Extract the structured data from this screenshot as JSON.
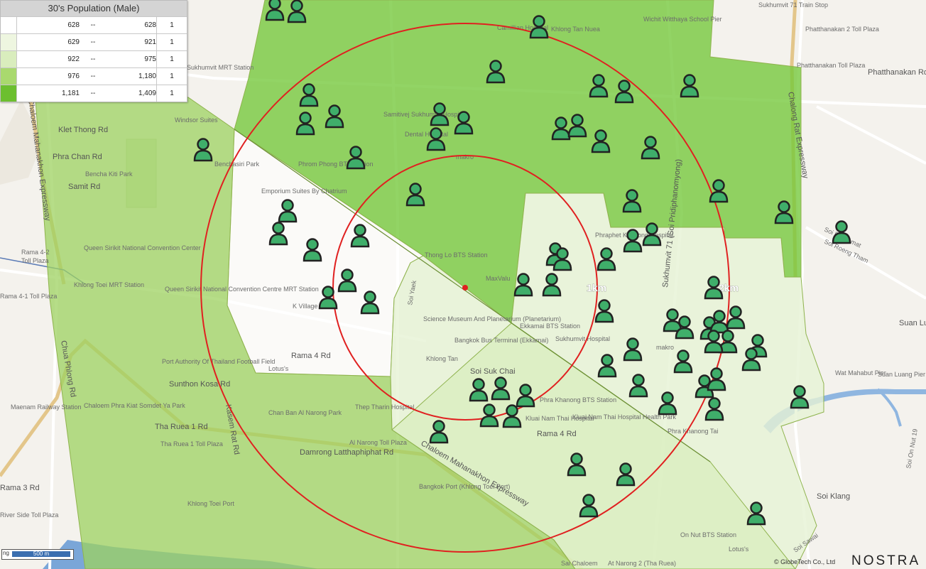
{
  "legend": {
    "title": "30's Population (Male)",
    "rows": [
      {
        "min": "628",
        "sep": "--",
        "max": "628",
        "count": "1",
        "color": "#ffffff"
      },
      {
        "min": "629",
        "sep": "--",
        "max": "921",
        "count": "1",
        "color": "#eef6e0"
      },
      {
        "min": "922",
        "sep": "--",
        "max": "975",
        "count": "1",
        "color": "#d9edbd"
      },
      {
        "min": "976",
        "sep": "--",
        "max": "1,180",
        "count": "1",
        "color": "#a9d96e"
      },
      {
        "min": "1,181",
        "sep": "--",
        "max": "1,409",
        "count": "1",
        "color": "#6cbf2f"
      }
    ]
  },
  "rings": {
    "inner": "1km",
    "outer": "2km"
  },
  "scale": {
    "label": "500 m",
    "prefix": "ng"
  },
  "copyright": "© GlobeTech Co., Ltd",
  "brand": "NOSTRA",
  "place_labels": {
    "sukhumvit_mrt": "Sukhumvit MRT Station",
    "klet_thong": "Klet Thong Rd",
    "phra_chan": "Phra Chan Rd",
    "samit": "Samit Rd",
    "benchakitti_park": "Bencha Kiti Park",
    "rama42": "Rama 4-2",
    "toll_plaza": "Toll Plaza",
    "rama41": "Rama 4-1 Toll Plaza",
    "qsncc": "Queen Sirikit National Convention Center",
    "khlong_toei_mrt": "Khlong Toei MRT Station",
    "qsncc_mrt": "Queen Sirikit National Convention Centre MRT Station",
    "port_authority": "Port Authority Of Thailand Football Field",
    "sunthon_kosa": "Sunthon Kosa Rd",
    "maenam_railway": "Maenam Railway Station",
    "chaloem_phra_kiat": "Chaloem Phra Kiat Somdet Ya Park",
    "tha_ruea_1": "Tha Ruea 1 Rd",
    "tha_ruea_toll": "Tha Ruea 1 Toll Plaza",
    "rama3": "Rama 3 Rd",
    "river_side": "River Side Toll Plaza",
    "klong_toei_port": "Khlong Toei Port",
    "damrong": "Damrong Latthaphiphat Rd",
    "bangkok_port": "Bangkok Port (Khlong Toei Port)",
    "al_narong_toll": "Al Narong Toll Plaza",
    "chan_ban": "Chan Ban Al Narong Park",
    "kasem_rat": "Kasem Rat Rd",
    "rama4": "Rama 4 Rd",
    "rama4b": "Rama 4 Rd",
    "lotus": "Lotus's",
    "k_village": "K Village",
    "emporium": "Emporium Suites By Chatrium",
    "phrom_phong": "Phrom Phong BTS Station",
    "benchasiri": "Benchasiri Park",
    "thong_lo": "Thong Lo BTS Station",
    "samitivej": "Samitivej Sukhumvit Hospital",
    "dental": "Dental Hospital",
    "camillian": "Camillian Hospital",
    "khlong_tan_nuea": "Khlong Tan Nuea",
    "sukhumvit71": "Sukhumvit 71 Train Stop",
    "phatthanakan_2": "Phatthanakan 2 Toll Plaza",
    "phatthanakan_tp": "Phatthanakan Toll Plaza",
    "phatthanakan_rd": "Phatthanakan Rd",
    "chalong_rat": "Chalong Rat Expressway",
    "wichit": "Wichit Witthaya School Pier",
    "soi_pridi": "Sukhumvit 71 (Soi Pridiphanomyong)",
    "soi_phakamat": "Soi Phakamat",
    "soi_roeng_tham": "Soi Roeng Tham",
    "phrakhanong_hosp": "Phraphet Khanong Hospital",
    "science_museum": "Science Museum And Planetarium (Planetarium)",
    "ekkamai_bts": "Ekkamai BTS Station",
    "sukhumvit_hosp": "Sukhumvit Hospital",
    "bangkok_bus": "Bangkok Bus Terminal (Ekkamai)",
    "soi_suk_chai": "Soi Suk Chai",
    "thep_tharin": "Thep Tharin Hospital",
    "phra_khanong_bts": "Phra Khanong BTS Station",
    "kluai_nam_thai": "Kluai Nam Thai Hospital",
    "kluai_nam_thai_hc": "Kluai Nam Thai Hospital Health Park",
    "chaloem_maha_exp": "Chaloem Mahanakhon Expressway",
    "chaloem_maha_exp2": "Chaloem Mahanakhon Expressway",
    "phra_khanong": "Phra Khanong Tai",
    "on_nut_bts": "On Nut BTS Station",
    "soi_klang": "Soi Klang",
    "soi_sawai": "Soi Sawai",
    "wat_mahabut": "Wat Mahabut Pier",
    "suan_luang": "Suan Luang Pier",
    "suan_luang2": "Suan Lu",
    "soi_on_nut": "Soi On Nut 19",
    "al_narong2": "At Narong 2 (Tha Ruea)",
    "sai_chaloem": "Sai Chaloem",
    "mavilla": "MaxValu",
    "makro": "makro",
    "makro2": "makro",
    "klong_tan": "Khlong Tan",
    "soi_yaek": "Soi Yaek",
    "chaloem_maha": "Chaloem Mahanakhon Expressway",
    "kasemrat_rd": "Kasem Rat Rd",
    "chua_phlong": "Chua Phlong Rd",
    "lotus2": "Lotus's",
    "windsor": "Windsor Suites"
  },
  "markers": [
    [
      387,
      12
    ],
    [
      418,
      15
    ],
    [
      759,
      37
    ],
    [
      698,
      100
    ],
    [
      435,
      133
    ],
    [
      843,
      120
    ],
    [
      879,
      128
    ],
    [
      971,
      120
    ],
    [
      471,
      163
    ],
    [
      430,
      173
    ],
    [
      619,
      160
    ],
    [
      653,
      172
    ],
    [
      614,
      195
    ],
    [
      790,
      180
    ],
    [
      813,
      176
    ],
    [
      846,
      198
    ],
    [
      916,
      207
    ],
    [
      286,
      210
    ],
    [
      501,
      221
    ],
    [
      585,
      273
    ],
    [
      1012,
      268
    ],
    [
      890,
      282
    ],
    [
      1104,
      298
    ],
    [
      1185,
      326
    ],
    [
      405,
      296
    ],
    [
      392,
      328
    ],
    [
      507,
      331
    ],
    [
      891,
      338
    ],
    [
      918,
      329
    ],
    [
      440,
      351
    ],
    [
      782,
      357
    ],
    [
      792,
      364
    ],
    [
      854,
      364
    ],
    [
      737,
      400
    ],
    [
      777,
      400
    ],
    [
      489,
      394
    ],
    [
      462,
      418
    ],
    [
      521,
      425
    ],
    [
      1005,
      404
    ],
    [
      851,
      437
    ],
    [
      947,
      450
    ],
    [
      964,
      460
    ],
    [
      1036,
      446
    ],
    [
      999,
      461
    ],
    [
      1013,
      452
    ],
    [
      1025,
      480
    ],
    [
      1067,
      486
    ],
    [
      1005,
      480
    ],
    [
      1058,
      505
    ],
    [
      891,
      491
    ],
    [
      962,
      508
    ],
    [
      855,
      514
    ],
    [
      992,
      543
    ],
    [
      1009,
      533
    ],
    [
      899,
      542
    ],
    [
      674,
      548
    ],
    [
      705,
      546
    ],
    [
      740,
      556
    ],
    [
      940,
      567
    ],
    [
      1006,
      575
    ],
    [
      1126,
      558
    ],
    [
      689,
      584
    ],
    [
      721,
      585
    ],
    [
      618,
      607
    ],
    [
      812,
      653
    ],
    [
      881,
      667
    ],
    [
      1065,
      722
    ],
    [
      829,
      711
    ]
  ]
}
